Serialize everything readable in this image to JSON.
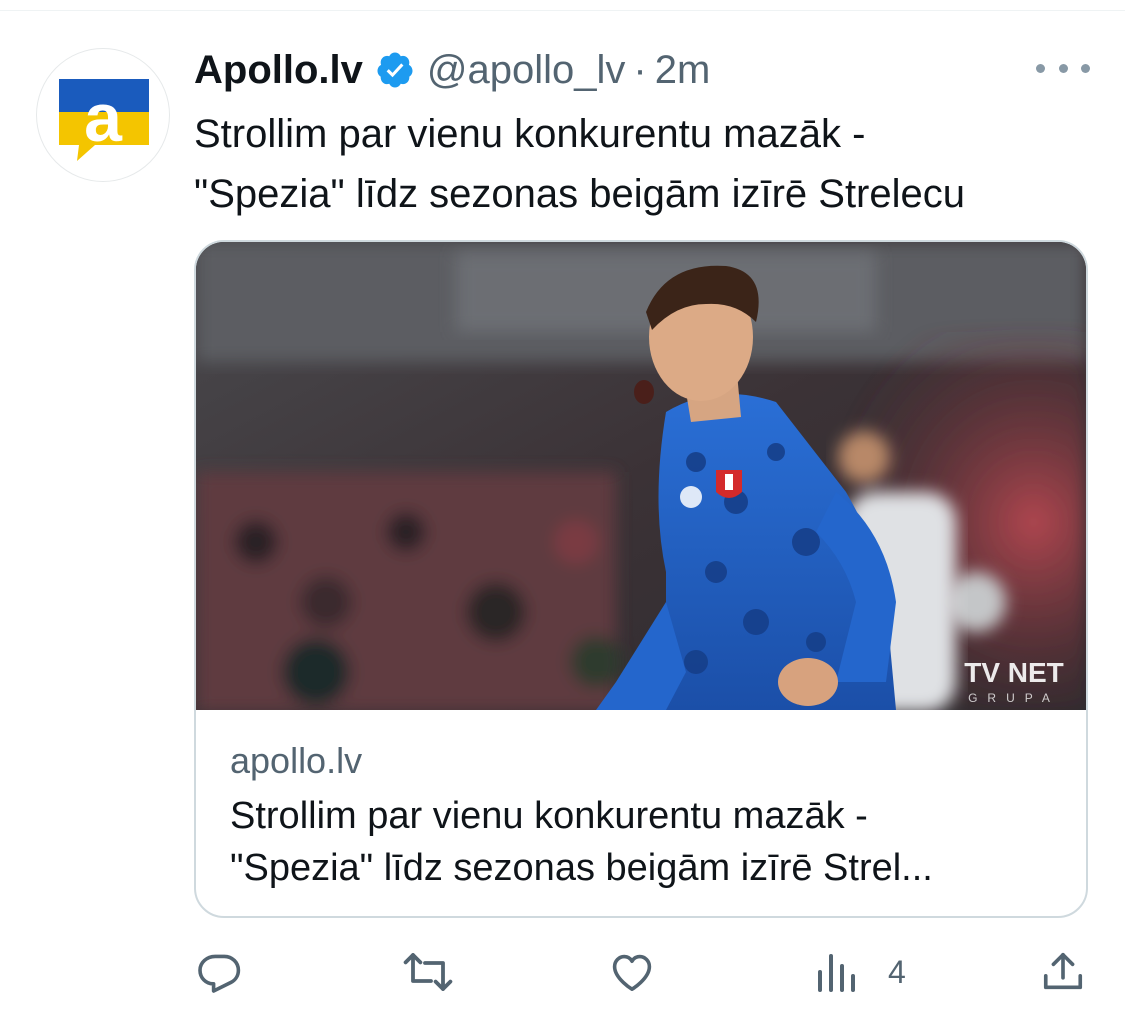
{
  "tweet": {
    "display_name": "Apollo.lv",
    "handle": "@apollo_lv",
    "separator": "·",
    "time": "2m",
    "text_lines": [
      "Strollim par vienu konkurentu mazāk -",
      "\"Spezia\" līdz sezonas beigām izīrē Strelecu"
    ],
    "avatar_letter": "a"
  },
  "card": {
    "image_icon": "photo-soccer-player",
    "watermark_top": "TV NET",
    "watermark_bottom": "GRUPA",
    "domain": "apollo.lv",
    "title_lines": [
      "Strollim par vienu konkurentu mazāk -",
      "\"Spezia\" līdz sezonas beigām izīrē Strel..."
    ]
  },
  "actions": {
    "reply_icon": "reply-icon",
    "retweet_icon": "retweet-icon",
    "like_icon": "heart-icon",
    "views_icon": "views-icon",
    "views_count": "4",
    "share_icon": "share-icon"
  },
  "colors": {
    "brand_blue": "#1d9bf0",
    "muted_text": "#536471",
    "border": "#cfd9de",
    "avatar_blue": "#1a5bbd",
    "avatar_yellow": "#f4c500"
  }
}
